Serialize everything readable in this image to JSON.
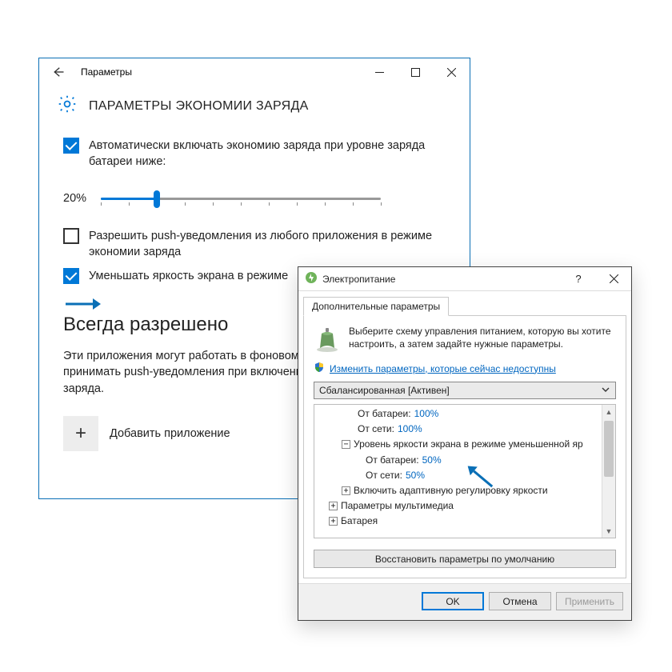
{
  "settings": {
    "title": "Параметры",
    "header": "ПАРАМЕТРЫ ЭКОНОМИИ ЗАРЯДА",
    "chkAuto": {
      "label": "Автоматически включать экономию заряда при уровне заряда батареи ниже:",
      "checked": true
    },
    "slider": {
      "value_label": "20%",
      "percent": 20
    },
    "chkPush": {
      "label": "Разрешить push-уведомления из любого приложения в режиме экономии заряда",
      "checked": false
    },
    "chkDim": {
      "label": "Уменьшать яркость экрана в режиме",
      "checked": true
    },
    "section_always": "Всегда разрешено",
    "section_desc": "Эти приложения могут работать в фоновом режиме, отправлять и принимать push-уведомления при включенной функции экономии заряда.",
    "add_app": "Добавить приложение"
  },
  "power": {
    "title": "Электропитание",
    "tab": "Дополнительные параметры",
    "intro": "Выберите схему управления питанием, которую вы хотите настроить, а затем задайте нужные параметры.",
    "change_link": "Изменить параметры, которые сейчас недоступны",
    "plan_selected": "Сбалансированная [Активен]",
    "tree": {
      "row1_label": "От батареи:",
      "row1_val": "100%",
      "row2_label": "От сети:",
      "row2_val": "100%",
      "row3_label": "Уровень яркости экрана в режиме уменьшенной яр",
      "row4_label": "От батареи:",
      "row4_val": "50%",
      "row5_label": "От сети:",
      "row5_val": "50%",
      "row6_label": "Включить адаптивную регулировку яркости",
      "row7_label": "Параметры мультимедиа",
      "row8_label": "Батарея"
    },
    "restore_defaults": "Восстановить параметры по умолчанию",
    "ok": "OK",
    "cancel": "Отмена",
    "apply": "Применить"
  }
}
